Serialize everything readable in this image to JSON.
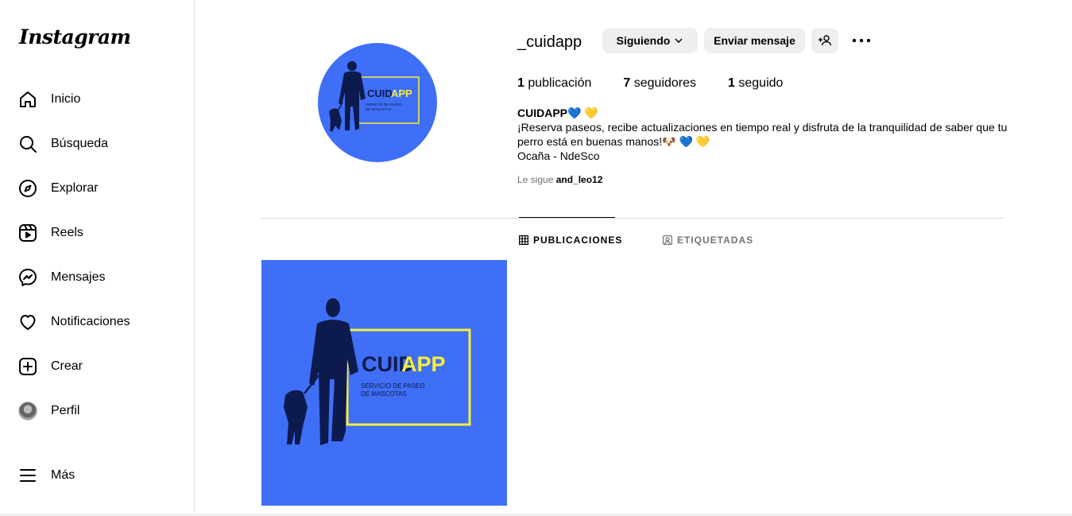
{
  "sidebar": {
    "logo": "Instagram",
    "items": [
      {
        "label": "Inicio",
        "icon": "home-icon"
      },
      {
        "label": "Búsqueda",
        "icon": "search-icon"
      },
      {
        "label": "Explorar",
        "icon": "compass-icon"
      },
      {
        "label": "Reels",
        "icon": "reels-icon"
      },
      {
        "label": "Mensajes",
        "icon": "messenger-icon"
      },
      {
        "label": "Notificaciones",
        "icon": "heart-icon"
      },
      {
        "label": "Crear",
        "icon": "plus-square-icon"
      },
      {
        "label": "Perfil",
        "icon": "avatar"
      }
    ],
    "more_label": "Más"
  },
  "profile": {
    "username": "_cuidapp",
    "follow_button": "Siguiendo",
    "message_button": "Enviar mensaje",
    "stats": {
      "posts_count": "1",
      "posts_label": " publicación",
      "followers_count": "7",
      "followers_label": " seguidores",
      "following_count": "1",
      "following_label": " seguido"
    },
    "bio": {
      "name": "CUIDAPP💙 💛",
      "line1": "¡Reserva paseos, recibe actualizaciones en tiempo real y disfruta de la tranquilidad de saber que tu perro está en buenas manos!🐶 💙 💛",
      "line2": "Ocaña - NdeSco"
    },
    "followed_by_prefix": "Le sigue ",
    "followed_by_user": "and_leo12"
  },
  "tabs": {
    "posts": "PUBLICACIONES",
    "tagged": "ETIQUETADAS"
  },
  "logo_art": {
    "brand_dark": "CUID",
    "brand_light": "APP",
    "tagline_1": "SERVICIO DE PASEO",
    "tagline_2": "DE MASCOTAS"
  },
  "colors": {
    "brand_blue": "#3f6ff7",
    "brand_yellow": "#f7ee3a",
    "silhouette": "#0d1a4d"
  }
}
